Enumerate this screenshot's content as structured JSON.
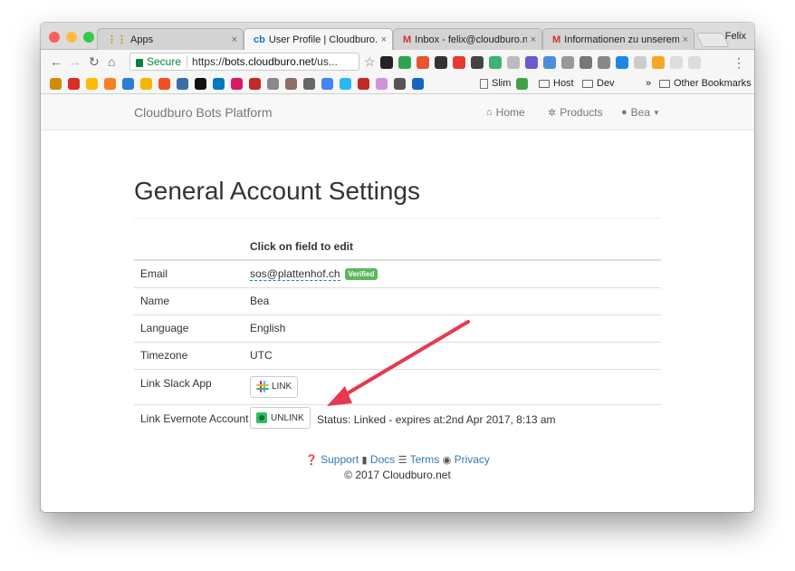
{
  "browser": {
    "tabs": [
      {
        "icon": "apps-grid-icon",
        "label": "Apps",
        "close": "×"
      },
      {
        "icon": "cb-favicon",
        "label": "User Profile | Cloudburo.n",
        "close": "×"
      },
      {
        "icon": "gmail-icon",
        "label": "Inbox - felix@cloudburo.n",
        "close": "×"
      },
      {
        "icon": "gmail-icon",
        "label": "Informationen zu unserem",
        "close": "×"
      }
    ],
    "profile_name": "Felix",
    "secure_label": "Secure",
    "url_prefix": "https://",
    "url_host": "bots.cloudburo.net",
    "url_rest": "/us...",
    "bookmarks": {
      "slim": "Slim",
      "host": "Host",
      "dev": "Dev",
      "overflow": "»",
      "other": "Other Bookmarks"
    }
  },
  "navbar": {
    "brand": "Cloudburo Bots Platform",
    "home": "Home",
    "products": "Products",
    "user": "Bea"
  },
  "page": {
    "title": "General Account Settings",
    "table_header": "Click on field to edit",
    "rows": [
      {
        "label": "Email",
        "value": "sos@plattenhof.ch",
        "badge": "Verified"
      },
      {
        "label": "Name",
        "value": "Bea"
      },
      {
        "label": "Language",
        "value": "English"
      },
      {
        "label": "Timezone",
        "value": "UTC"
      },
      {
        "label": "Link Slack App",
        "button": "LINK"
      },
      {
        "label": "Link Evernote Account",
        "button": "UNLINK",
        "status": "Status: Linked - expires at:2nd Apr 2017, 8:13 am"
      }
    ]
  },
  "footer": {
    "support": "Support",
    "docs": "Docs",
    "terms": "Terms",
    "privacy": "Privacy",
    "copyright": "© 2017 Cloudburo.net"
  },
  "colors": {
    "link": "#337ab7",
    "verified_badge": "#5cb85c",
    "annotation_arrow": "#e8384f"
  }
}
